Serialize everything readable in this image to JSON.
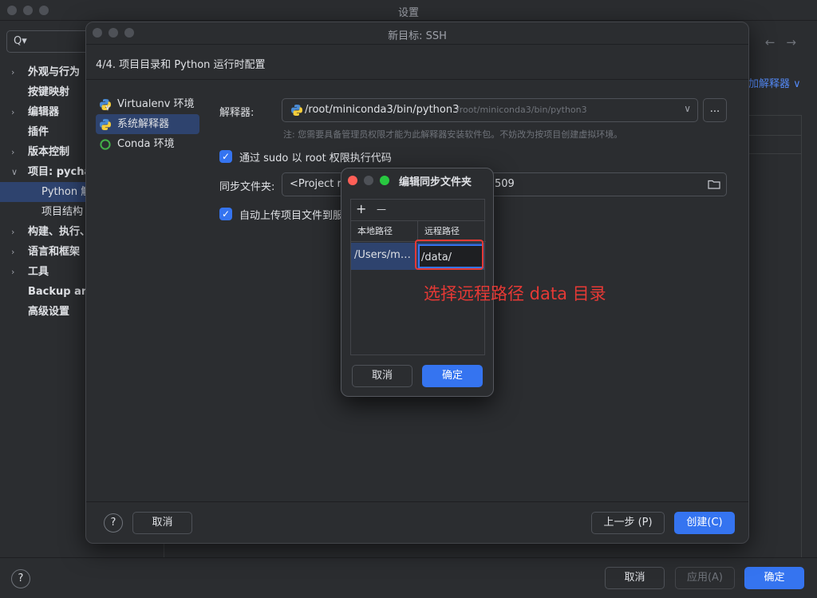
{
  "outer": {
    "title": "设置",
    "search_icon": "Q▾",
    "tree": [
      {
        "label": "外观与行为",
        "expandable": true
      },
      {
        "label": "按键映射",
        "expandable": false
      },
      {
        "label": "编辑器",
        "expandable": true
      },
      {
        "label": "插件",
        "expandable": false
      },
      {
        "label": "版本控制",
        "expandable": true
      },
      {
        "label": "项目: pycha",
        "expandable": true,
        "expanded": true
      },
      {
        "label": "Python 解",
        "child": true,
        "selected": true
      },
      {
        "label": "项目结构",
        "child": true
      },
      {
        "label": "构建、执行、",
        "expandable": true
      },
      {
        "label": "语言和框架",
        "expandable": true
      },
      {
        "label": "工具",
        "expandable": true
      },
      {
        "label": "Backup and",
        "expandable": false
      },
      {
        "label": "高级设置",
        "expandable": false
      }
    ],
    "add_interpreter_label": "加解释器 ∨",
    "nav_back": "←",
    "nav_forward": "→",
    "help": "?",
    "cancel_label": "取消",
    "apply_label": "应用(A)",
    "ok_label": "确定"
  },
  "ssh_dialog": {
    "title": "新目标: SSH",
    "step": "4/4. 项目目录和 Python 运行时配置",
    "env_options": [
      {
        "label": "Virtualenv 环境",
        "icon": "virtualenv-icon"
      },
      {
        "label": "系统解释器",
        "icon": "python-icon",
        "selected": true
      },
      {
        "label": "Conda 环境",
        "icon": "conda-icon"
      }
    ],
    "interpreter_label": "解释器:",
    "interpreter_value": "/root/miniconda3/bin/python3",
    "interpreter_path_hint": "/root/miniconda3/bin/python3",
    "browse_label": "...",
    "note": "注: 您需要具备管理员权限才能为此解释器安装软件包。不妨改为按项目创建虚拟环境。",
    "sudo_label": "通过 sudo 以 root 权限执行代码",
    "sync_folder_label": "同步文件夹:",
    "sync_folder_value": "<Project r",
    "sync_folder_suffix": "509",
    "auto_upload_label": "自动上传项目文件到服",
    "help": "?",
    "cancel_label": "取消",
    "prev_label": "上一步 (P)",
    "create_label": "创建(C)"
  },
  "sync_dialog": {
    "title": "编辑同步文件夹",
    "add": "+",
    "remove": "—",
    "col_local": "本地路径",
    "col_remote": "远程路径",
    "local_value": "/Users/ma...",
    "remote_value": "/data/",
    "cancel_label": "取消",
    "ok_label": "确定"
  },
  "annotation": {
    "text": "选择远程路径 data 目录",
    "color": "#e53935"
  },
  "colors": {
    "accent": "#3574f0",
    "selection": "#2e436e",
    "background": "#2b2d30"
  }
}
